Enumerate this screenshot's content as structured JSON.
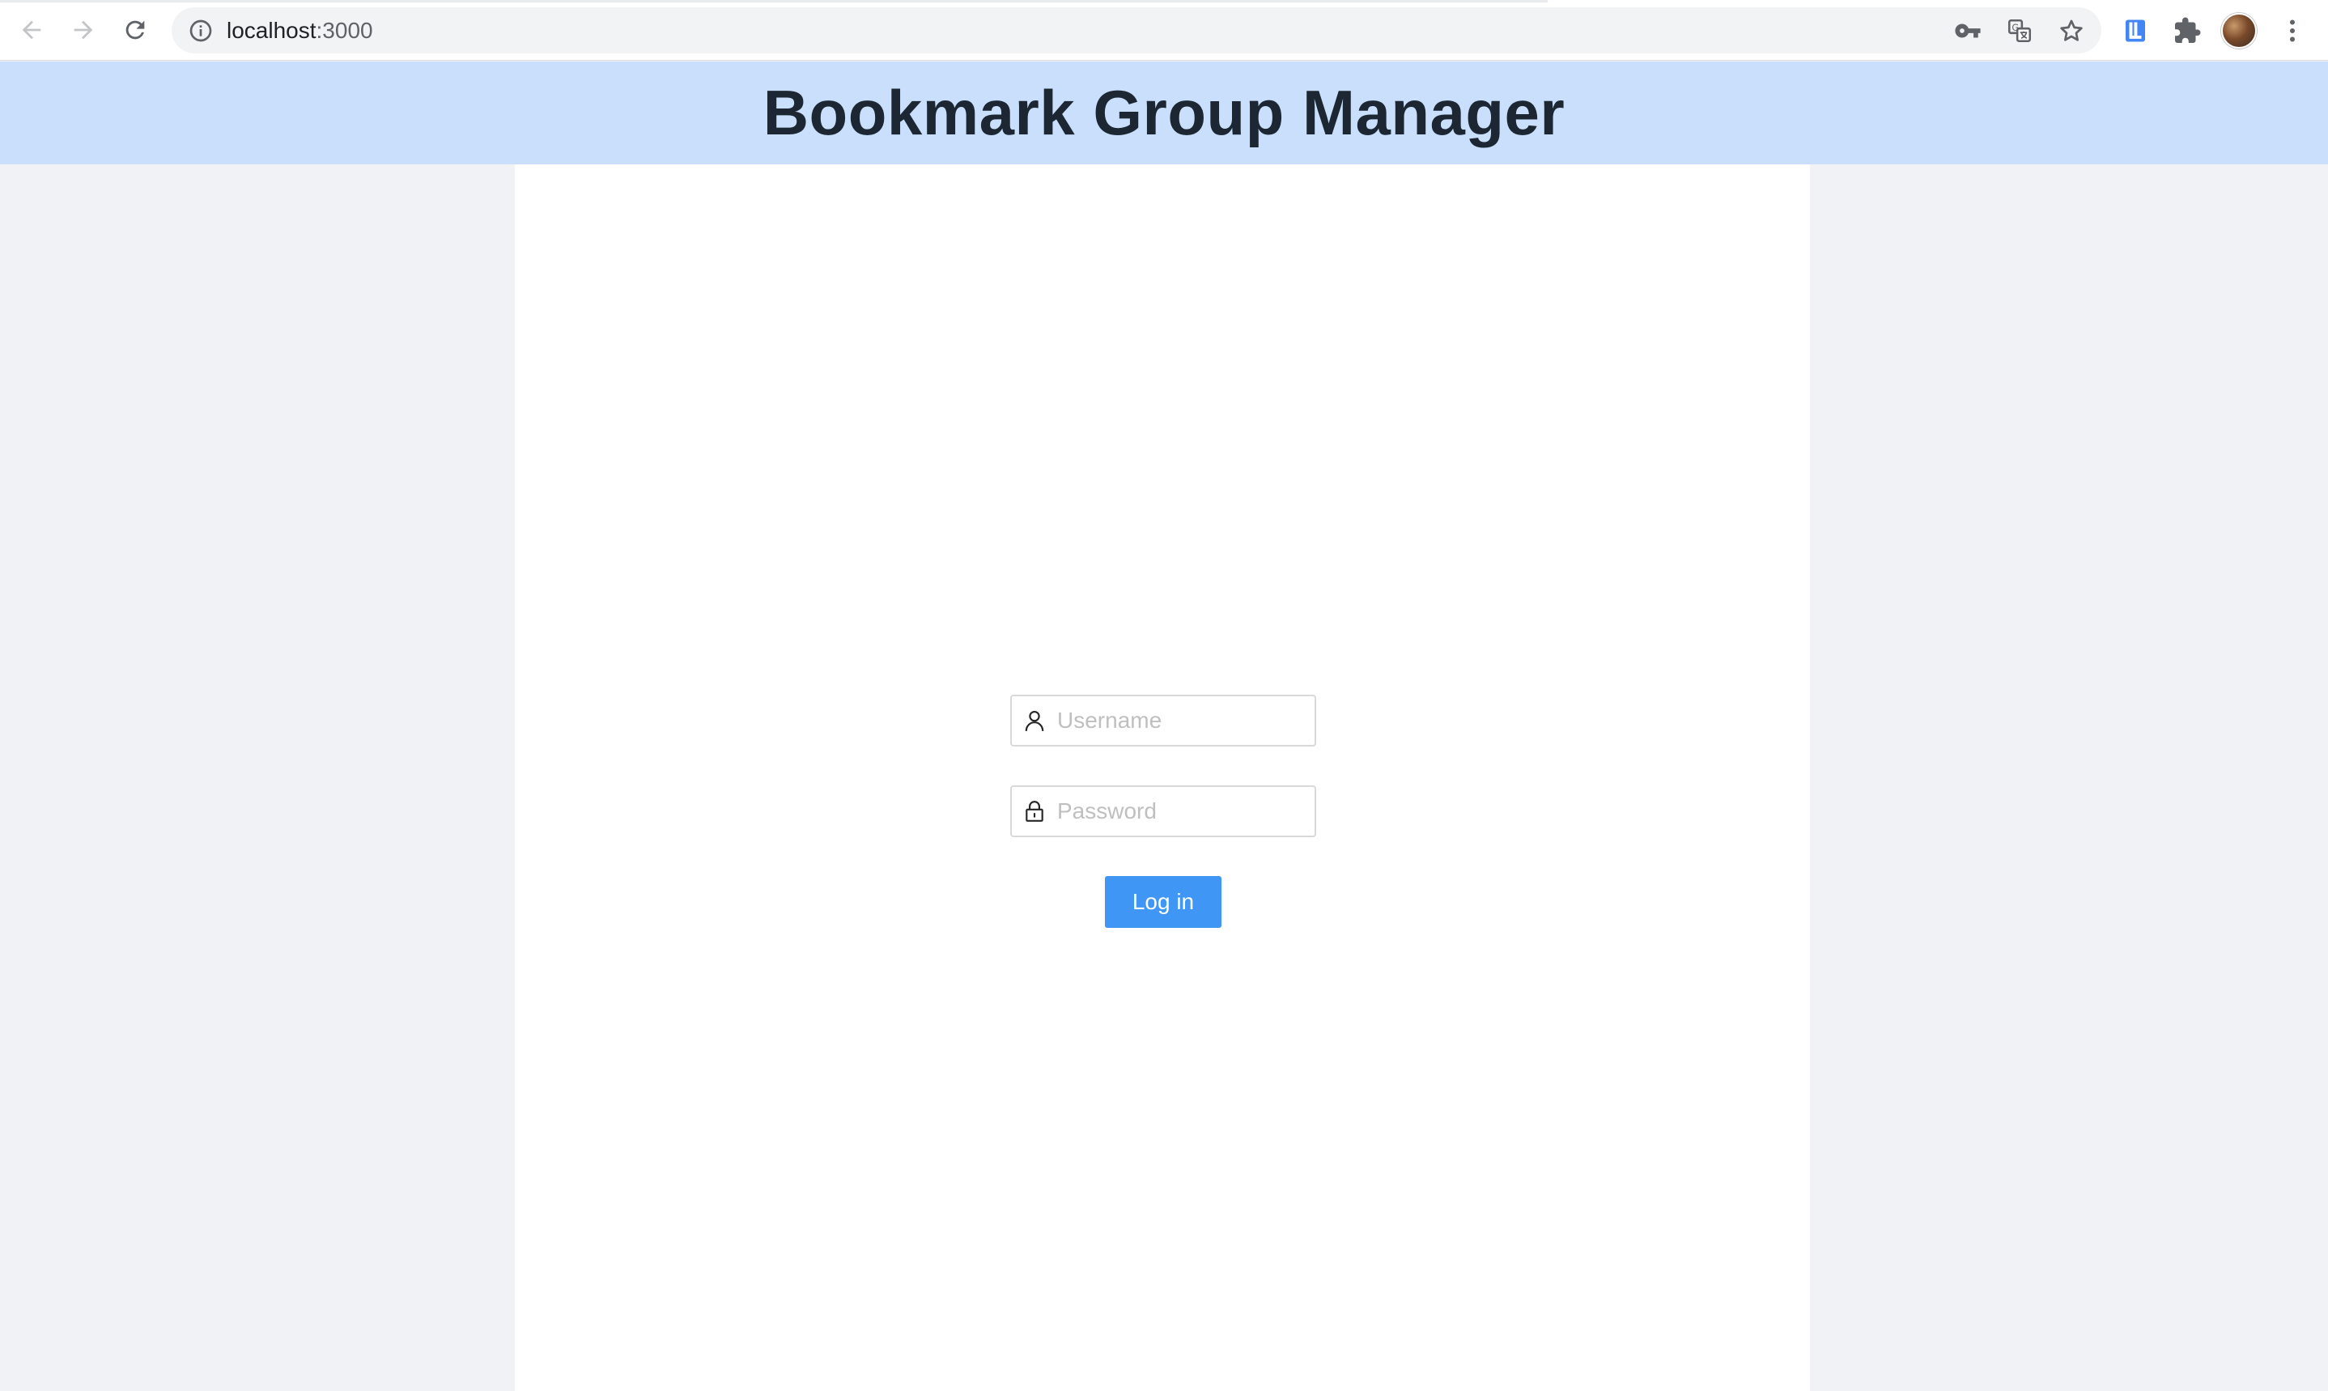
{
  "browser": {
    "url_host": "localhost",
    "url_port": ":3000"
  },
  "app": {
    "title": "Bookmark Group Manager"
  },
  "login": {
    "username_placeholder": "Username",
    "password_placeholder": "Password",
    "submit_label": "Log in"
  },
  "colors": {
    "header_bg": "#c9dffb",
    "button_bg": "#4096f5",
    "page_bg": "#f0f2f5"
  }
}
